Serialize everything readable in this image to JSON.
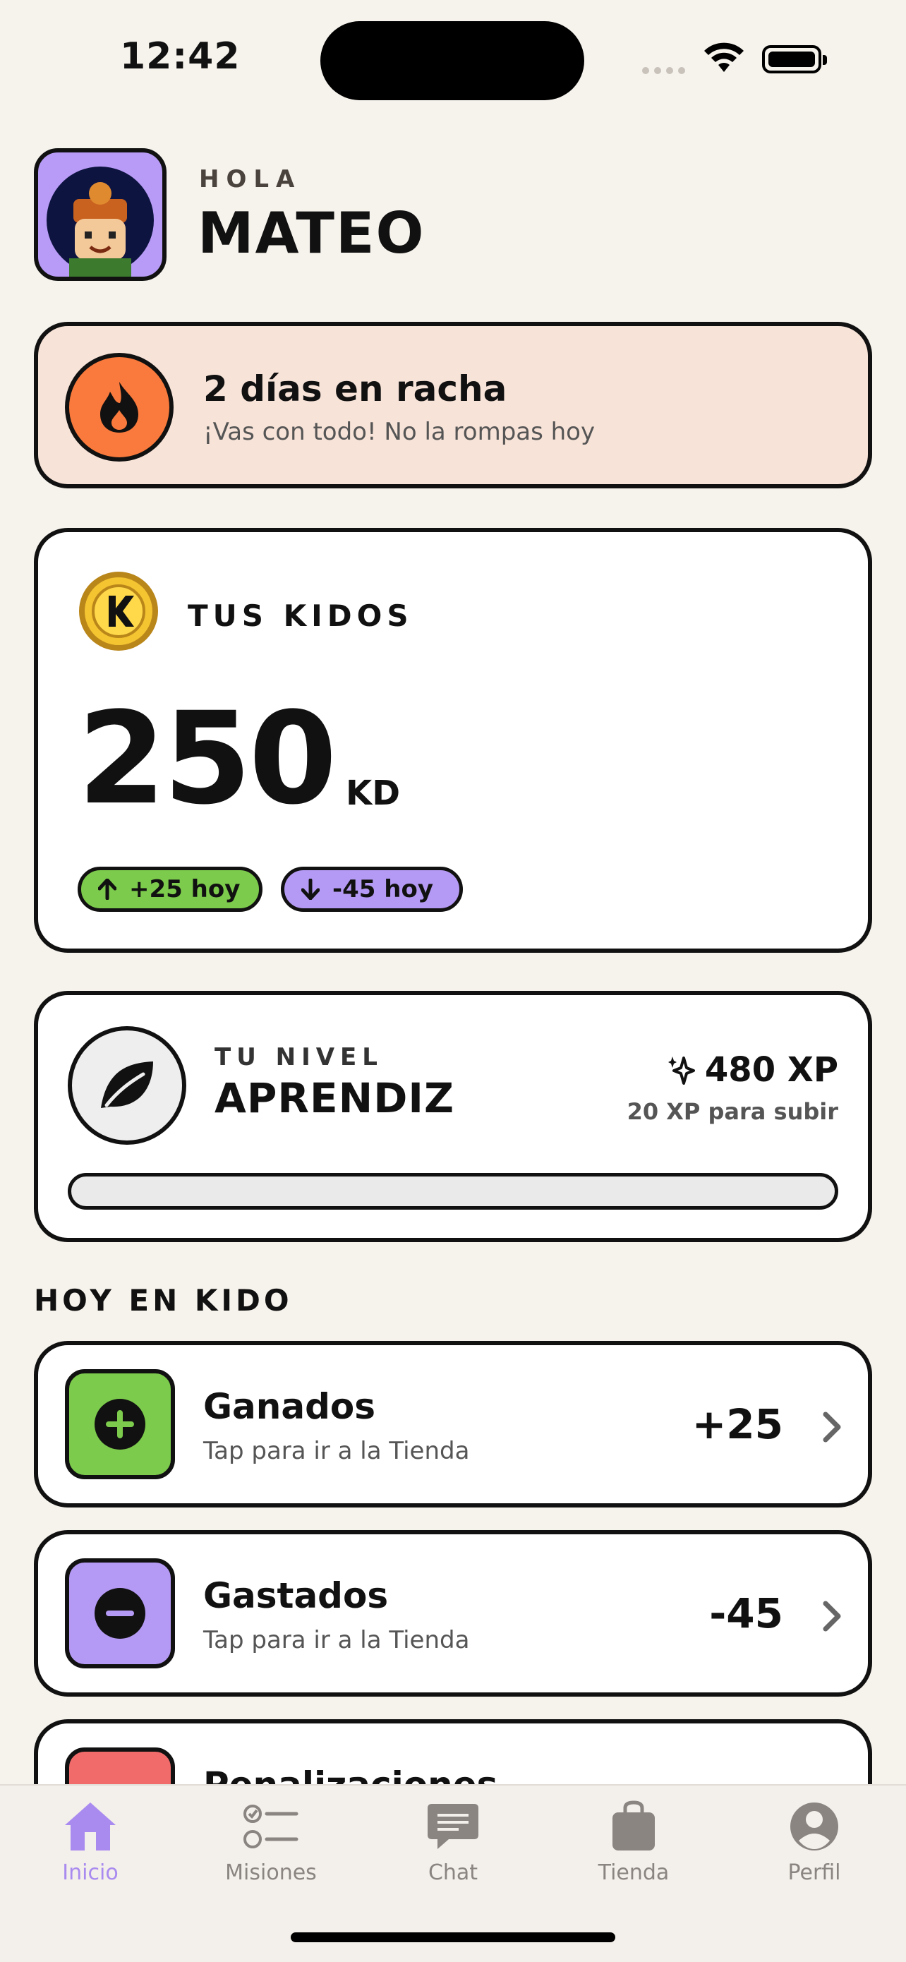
{
  "status_bar": {
    "time": "12:42"
  },
  "header": {
    "greeting": "HOLA",
    "name": "MATEO"
  },
  "streak": {
    "title": "2 días en racha",
    "subtitle": "¡Vas con todo! No la rompas hoy",
    "icon": "flame-icon",
    "color": "#F97A3C"
  },
  "kidos": {
    "label": "TUS KIDOS",
    "value": "250",
    "unit": "KD",
    "earned_pill": "+25 hoy",
    "spent_pill": "-45 hoy"
  },
  "level": {
    "label": "TU NIVEL",
    "name": "APRENDIZ",
    "xp": "480 XP",
    "to_next": "20 XP para subir",
    "progress_fraction": 0
  },
  "section": {
    "title": "HOY EN KIDO"
  },
  "rows": [
    {
      "title": "Ganados",
      "subtitle": "Tap para ir a la Tienda",
      "value": "+25",
      "color": "#7CCB4C",
      "icon": "plus-circle-icon"
    },
    {
      "title": "Gastados",
      "subtitle": "Tap para ir a la Tienda",
      "value": "-45",
      "color": "#B59AF5",
      "icon": "minus-circle-icon"
    },
    {
      "title": "Penalizaciones",
      "subtitle": "",
      "value": "",
      "color": "#F26B6B",
      "icon": "penalty-icon"
    }
  ],
  "tabs": [
    {
      "label": "Inicio",
      "icon": "home-icon",
      "active": true
    },
    {
      "label": "Misiones",
      "icon": "checklist-icon",
      "active": false
    },
    {
      "label": "Chat",
      "icon": "chat-icon",
      "active": false
    },
    {
      "label": "Tienda",
      "icon": "bag-icon",
      "active": false
    },
    {
      "label": "Perfil",
      "icon": "person-icon",
      "active": false
    }
  ],
  "colors": {
    "background": "#F6F2EC",
    "accent": "#A98BF0",
    "green": "#7CCB4C",
    "purple": "#B59AF5"
  }
}
